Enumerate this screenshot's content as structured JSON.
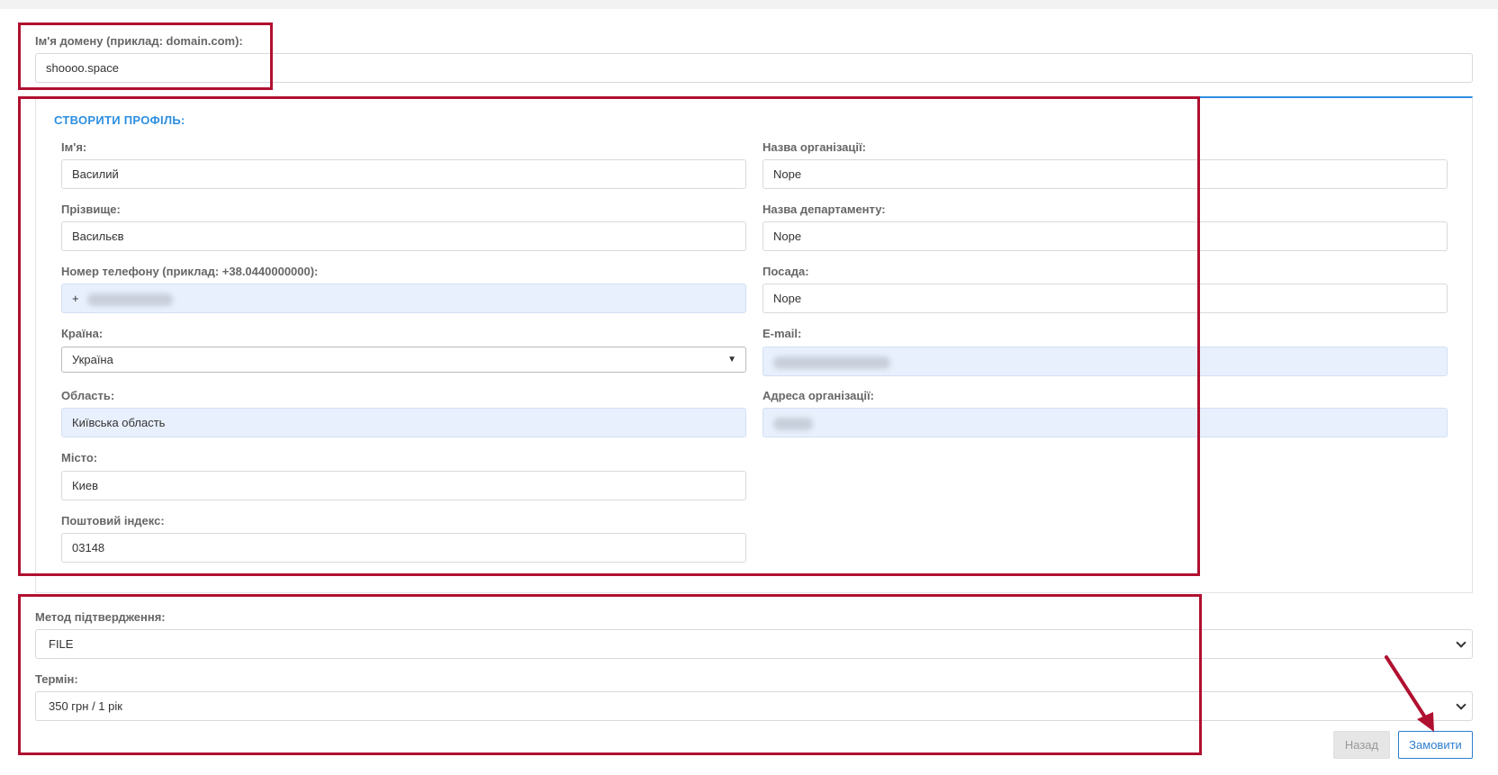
{
  "domain": {
    "label": "Ім'я домену (приклад: domain.com):",
    "value": "shoooo.space"
  },
  "profile": {
    "title": "СТВОРИТИ ПРОФІЛЬ:",
    "left": [
      {
        "label": "Ім'я:",
        "value": "Василий"
      },
      {
        "label": "Прізвище:",
        "value": "Васильєв"
      },
      {
        "label": "Номер телефону (приклад: +38.0440000000):",
        "value": "+"
      },
      {
        "label": "Країна:",
        "value": "Україна"
      },
      {
        "label": "Область:",
        "value": "Київська область"
      },
      {
        "label": "Місто:",
        "value": "Киев"
      },
      {
        "label": "Поштовий індекс:",
        "value": "03148"
      }
    ],
    "right": [
      {
        "label": "Назва організації:",
        "value": "Nope"
      },
      {
        "label": "Назва департаменту:",
        "value": "Nope"
      },
      {
        "label": "Посада:",
        "value": "Nope"
      },
      {
        "label": "E-mail:",
        "value": ""
      },
      {
        "label": "Адреса організації:",
        "value": ""
      }
    ]
  },
  "verification": {
    "label": "Метод підтвердження:",
    "value": "FILE"
  },
  "term": {
    "label": "Термін:",
    "value": "350 грн / 1 рік"
  },
  "buttons": {
    "back": "Назад",
    "order": "Замовити"
  },
  "colors": {
    "accent": "#2d8fe0",
    "annotation": "#b01030",
    "filled_input": "#e8f0fd"
  }
}
